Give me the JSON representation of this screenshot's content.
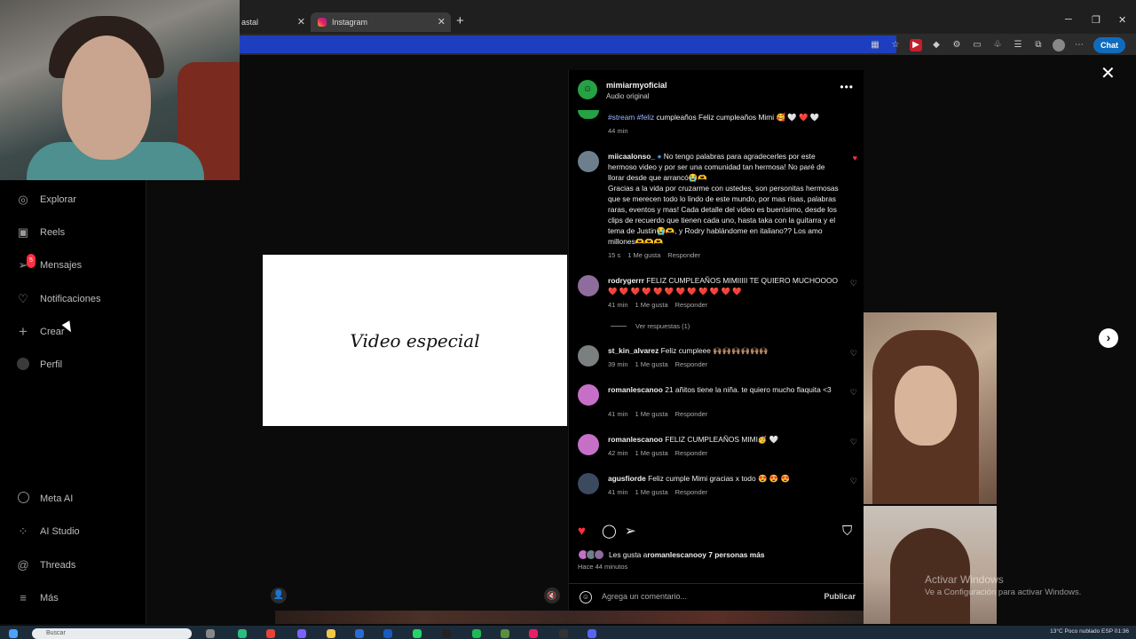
{
  "browser": {
    "tabs": [
      {
        "label": "astal"
      },
      {
        "label": "Instagram"
      }
    ],
    "new_tab": "+",
    "chat_button": "Chat"
  },
  "sidebar": {
    "items": [
      {
        "label": "Explorar"
      },
      {
        "label": "Reels"
      },
      {
        "label": "Mensajes",
        "badge": "5"
      },
      {
        "label": "Notificaciones"
      },
      {
        "label": "Crear"
      },
      {
        "label": "Perfil"
      },
      {
        "label": "Meta AI"
      },
      {
        "label": "AI Studio"
      },
      {
        "label": "Threads"
      },
      {
        "label": "Más"
      }
    ]
  },
  "video": {
    "title": "Video especial"
  },
  "post": {
    "username": "mimiarmyoficial",
    "audio": "Audio original",
    "comments": [
      {
        "hashtags": "#stream #feliz",
        "text": " cumpleaños Feliz cumpleaños Mimi 🥰 🤍 ❤️ 🤍",
        "time": "44 min"
      },
      {
        "user": "miicaalonso_",
        "text": " No tengo palabras para agradecerles por este hermoso video y por ser una comunidad tan hermosa! No paré de llorar desde que arrancó😭🫶",
        "text2": "Gracias a la vida por cruzarme con ustedes, son personitas hermosas que se merecen todo lo lindo de este mundo, por mas risas, palabras raras, eventos y mas! Cada detalle del video es buenísimo, desde los clips de recuerdo que tienen cada uno, hasta taka con la guitarra y el tema de Justin😭🫶, y Rodry hablándome en italiano?? Los amo millones🫶🫶🫶",
        "time": "15 s",
        "likes": "1 Me gusta",
        "reply": "Responder"
      },
      {
        "user": "rodrygerrr",
        "text": " FELIZ CUMPLEAÑOS MIMIIIII TE QUIERO MUCHOOOO ❤️ ❤️ ❤️ ❤️ ❤️ ❤️ ❤️ ❤️ ❤️ ❤️ ❤️ ❤️",
        "time": "41 min",
        "likes": "1 Me gusta",
        "reply": "Responder",
        "view_replies": "Ver respuestas (1)"
      },
      {
        "user": "st_kin_alvarez",
        "text": " Feliz cumpleee 🙌🏽🙌🏽🙌🏽🙌🏽🙌🏽🙌🏽",
        "time": "39 min",
        "likes": "1 Me gusta",
        "reply": "Responder"
      },
      {
        "user": "romanlescanoo",
        "text": " 21 añitos tiene la niña. te quiero mucho flaquita <3",
        "time": "41 min",
        "likes": "1 Me gusta",
        "reply": "Responder"
      },
      {
        "user": "romanlescanoo",
        "text": " FELIZ CUMPLEAÑOS MIMI🥳 🤍",
        "time": "42 min",
        "likes": "1 Me gusta",
        "reply": "Responder"
      },
      {
        "user": "agusfiorde",
        "text": " Feliz cumple Mimi gracias x todo 😍 😍 😍",
        "time": "41 min",
        "likes": "1 Me gusta",
        "reply": "Responder"
      }
    ],
    "liked_by_prefix": "Les gusta a ",
    "liked_by_user": "romanlescanoo",
    "liked_by_suffix": " y 7 personas más",
    "posted_ago": "Hace 44 minutos",
    "comment_placeholder": "Agrega un comentario...",
    "post_button": "Publicar"
  },
  "watermark": {
    "line1": "Activar Windows",
    "line2": "Ve a Configuración para activar Windows."
  },
  "taskbar": {
    "search": "Buscar",
    "tray": "13°C  Poco nublado    ESP    01:36"
  },
  "colors": {
    "like_red": "#ff3040",
    "brand_green": "#25a244",
    "address_blue": "#1d3fbf"
  }
}
